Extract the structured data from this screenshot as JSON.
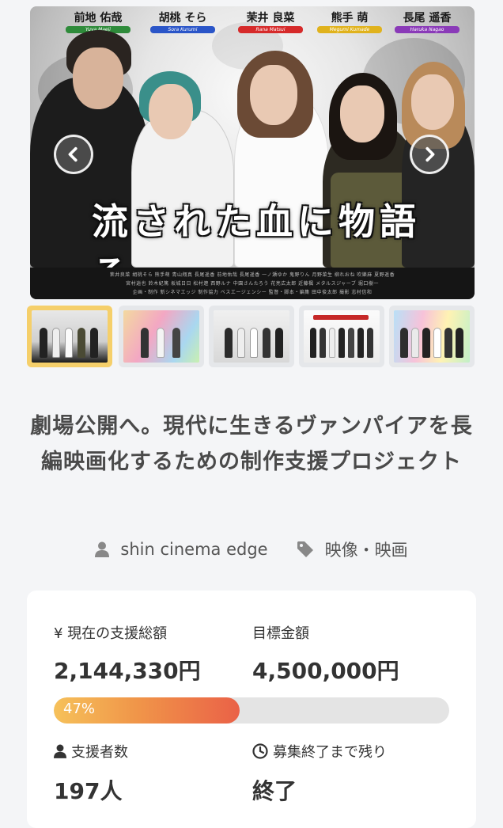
{
  "hero": {
    "film_title": "流された血に物語る。",
    "credits_line1": "茉井良菜  胡桃そら  熊手萌  青山翔真  長尾遥香  前地佑哉  長尾遥香  一ノ瀬ゆか  鬼野りん  月野菜生  柳れおね  吹樂麻  夏野遥香",
    "credits_line2": "宮村逍也  鈴木紀篤  坂城日日  松村遼  西野ルナ  中園さんたろう  花亮広太郎  近藤楓  メタルスジャーブ  堀口樹一",
    "credits_line3": "企画・制作 新シネマエッジ  制作協力 ベスエージェンシー  監督・脚本・編集 田中俊太郎  撮影 志村信和",
    "cast": [
      {
        "jp": "前地 佑哉",
        "en": "Yuya Maeji",
        "color": "#2e8b3a"
      },
      {
        "jp": "胡桃 そら",
        "en": "Sora Kurumi",
        "color": "#2a55c8"
      },
      {
        "jp": "茉井 良菜",
        "en": "Rana Matsui",
        "color": "#d62a2a"
      },
      {
        "jp": "熊手 萌",
        "en": "Megumi Kumade",
        "color": "#e0b21c"
      },
      {
        "jp": "長尾 遥香",
        "en": "Haruka Nagao",
        "color": "#8a3ab8"
      }
    ]
  },
  "icons": {
    "prev": "chevron-left-icon",
    "next": "chevron-right-icon",
    "user": "user-icon",
    "tag": "tag-icon",
    "users": "users-icon",
    "clock": "clock-icon"
  },
  "thumbnails": [
    {
      "id": "thumb-1",
      "active": true
    },
    {
      "id": "thumb-2",
      "active": false
    },
    {
      "id": "thumb-3",
      "active": false
    },
    {
      "id": "thumb-4",
      "active": false
    },
    {
      "id": "thumb-5",
      "active": false
    }
  ],
  "project": {
    "title": "劇場公開へ。現代に生きるヴァンパイアを長編映画化するための制作支援プロジェクト",
    "owner": "shin cinema edge",
    "category": "映像・映画"
  },
  "stats": {
    "raised_label": "¥ 現在の支援総額",
    "raised_value": "2,144,330円",
    "goal_label": "目標金額",
    "goal_value": "4,500,000円",
    "progress_text": "47%",
    "progress_fraction": 0.47,
    "backers_label": "支援者数",
    "backers_value": "197人",
    "remaining_label": "募集終了まで残り",
    "remaining_value": "終了"
  },
  "colors": {
    "accent_gold": "#f5cf6a",
    "progress_start": "#f6c15a",
    "progress_end": "#ea6147"
  }
}
